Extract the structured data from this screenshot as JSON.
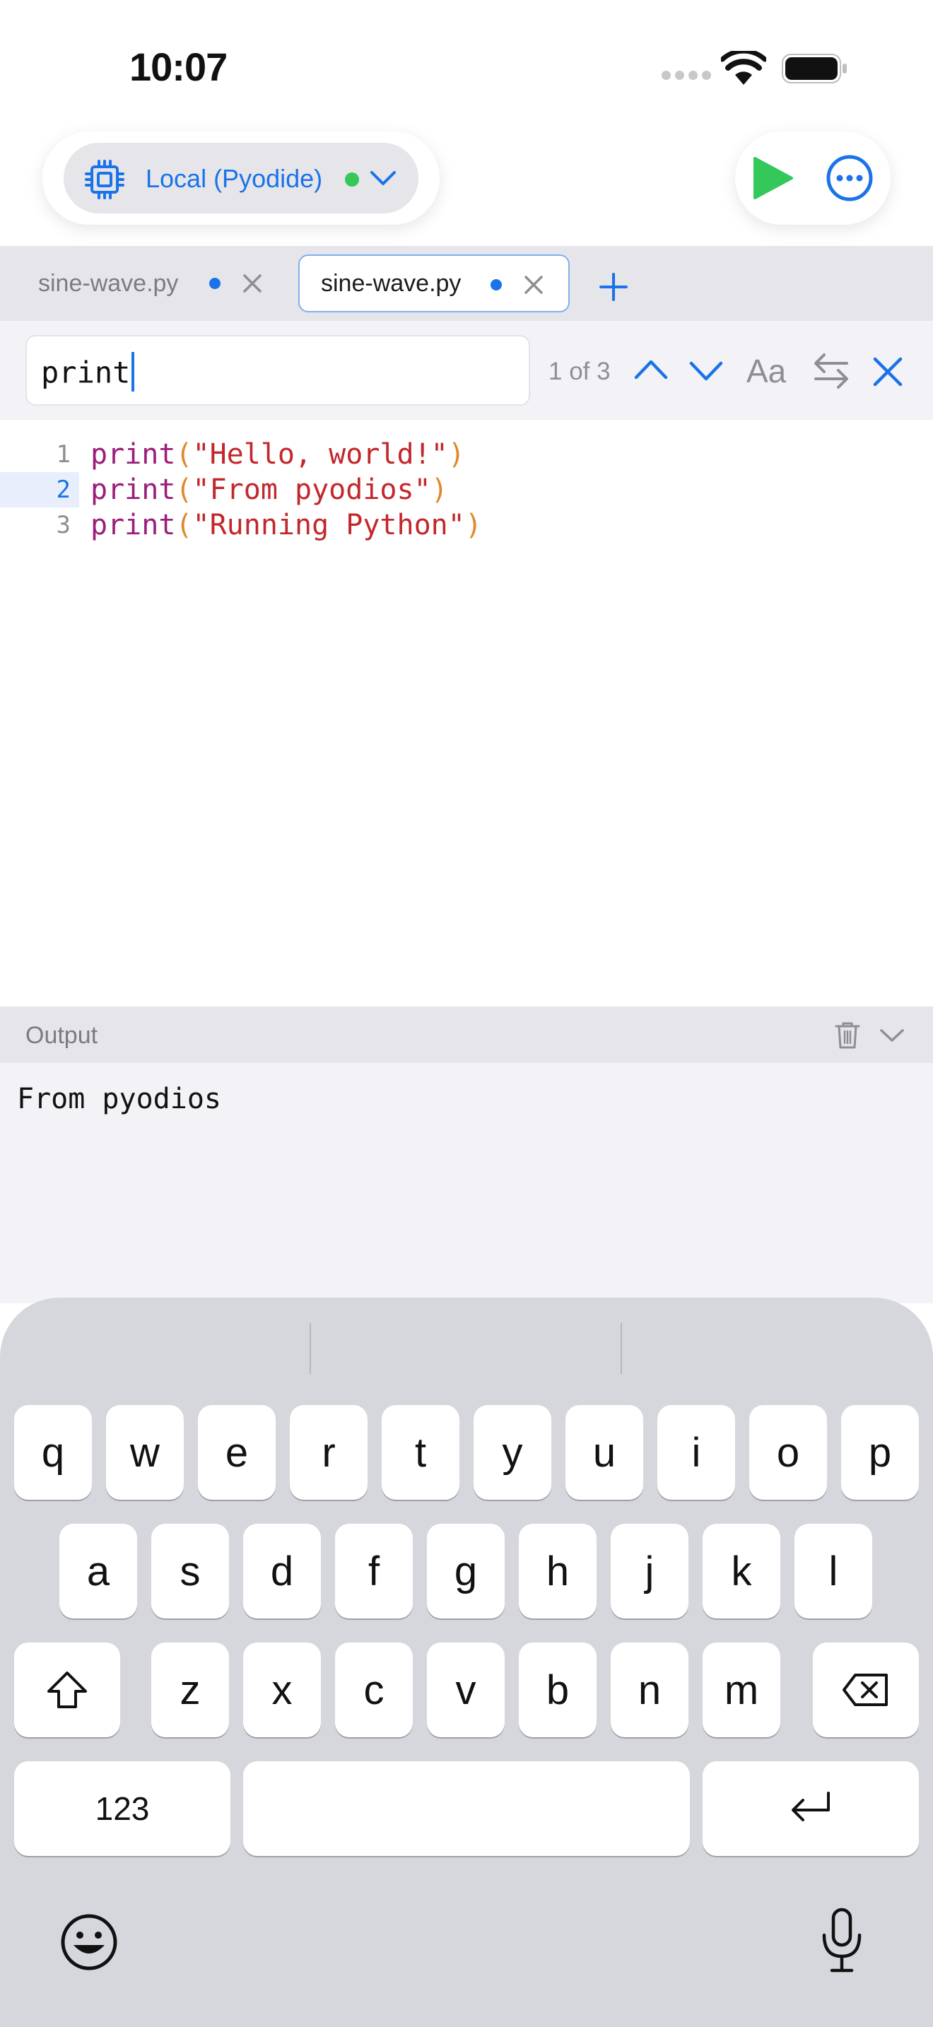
{
  "status_bar": {
    "time": "10:07"
  },
  "toolbar": {
    "runtime_label": "Local (Pyodide)",
    "colors": {
      "accent": "#1a73e8",
      "run": "#34c759",
      "status_ok": "#34c759"
    }
  },
  "tabs": [
    {
      "label": "sine-wave.py",
      "active": false,
      "modified": true
    },
    {
      "label": "sine-wave.py",
      "active": true,
      "modified": true
    }
  ],
  "find": {
    "query": "print",
    "match_count": "1 of 3",
    "case_label": "Aa"
  },
  "editor": {
    "lines": [
      {
        "number": "1",
        "fn": "print",
        "open": "(",
        "str": "\"Hello, world!\"",
        "close": ")"
      },
      {
        "number": "2",
        "fn": "print",
        "open": "(",
        "str": "\"From pyodios\"",
        "close": ")"
      },
      {
        "number": "3",
        "fn": "print",
        "open": "(",
        "str": "\"Running Python\"",
        "close": ")"
      }
    ]
  },
  "output": {
    "title": "Output",
    "text": "From pyodios"
  },
  "keyboard": {
    "row1": [
      "q",
      "w",
      "e",
      "r",
      "t",
      "y",
      "u",
      "i",
      "o",
      "p"
    ],
    "row2": [
      "a",
      "s",
      "d",
      "f",
      "g",
      "h",
      "j",
      "k",
      "l"
    ],
    "row3": [
      "z",
      "x",
      "c",
      "v",
      "b",
      "n",
      "m"
    ],
    "numbers_label": "123"
  }
}
